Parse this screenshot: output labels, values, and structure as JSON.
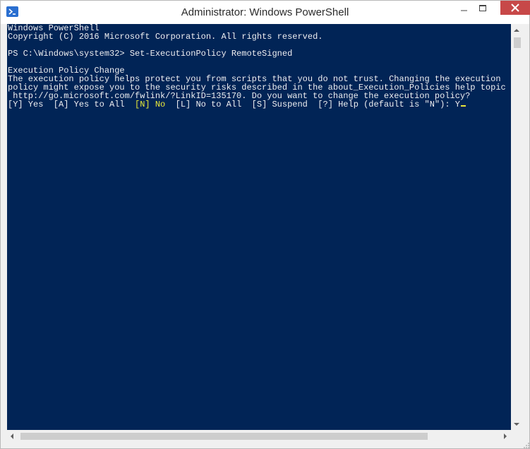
{
  "window": {
    "title": "Administrator: Windows PowerShell",
    "icon": "powershell-icon",
    "controls": [
      "minimize-icon",
      "maximize-icon",
      "close-icon"
    ]
  },
  "console": {
    "line1": "Windows PowerShell",
    "line2": "Copyright (C) 2016 Microsoft Corporation. All rights reserved.",
    "line3": "PS C:\\Windows\\system32> Set-ExecutionPolicy RemoteSigned",
    "line4": "Execution Policy Change",
    "line5": "The execution policy helps protect you from scripts that you do not trust. Changing the execution",
    "line6": "policy might expose you to the security risks described in the about_Execution_Policies help topic at",
    "line7": " http://go.microsoft.com/fwlink/?LinkID=135170. Do you want to change the execution policy?",
    "prompt": {
      "before": "[Y] Yes  [A] Yes to All  ",
      "default_option": "[N] No",
      "after": "  [L] No to All  [S] Suspend  [?] Help (default is \"N\"): ",
      "input": "Y"
    }
  },
  "colors": {
    "console_background": "#012456",
    "console_text": "#eeedf0",
    "highlight": "#e8e83a",
    "close_button": "#c74848"
  }
}
